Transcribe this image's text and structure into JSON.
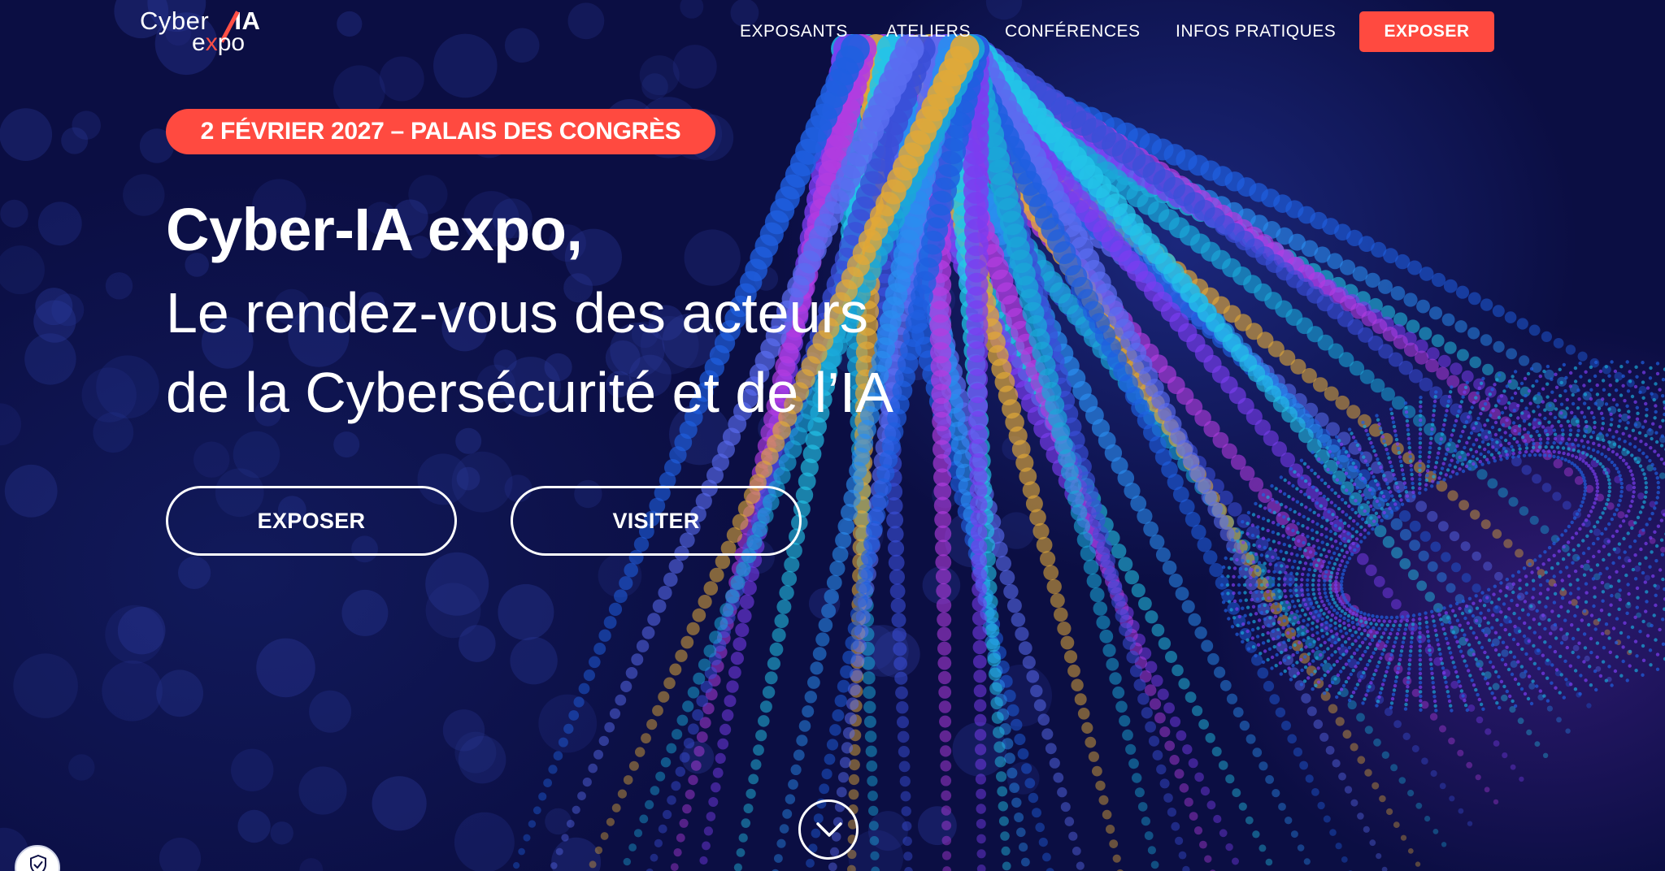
{
  "logo": {
    "word_top": "Cyber",
    "word_ia": "IA",
    "word_bottom_a": "e",
    "word_bottom_x": "x",
    "word_bottom_b": "po",
    "accent_color": "#ff4a40"
  },
  "nav": {
    "items": [
      {
        "label": "EXPOSANTS"
      },
      {
        "label": "ATELIERS"
      },
      {
        "label": "CONFÉRENCES"
      },
      {
        "label": "INFOS PRATIQUES"
      }
    ],
    "cta_label": "EXPOSER"
  },
  "hero": {
    "date_badge": "2 FÉVRIER 2027 – PALAIS DES CONGRÈS",
    "title": "Cyber-IA expo,",
    "subtitle_line1": "Le rendez-vous des acteurs",
    "subtitle_line2": "de la Cybersécurité et de l’IA",
    "button_expose": "EXPOSER",
    "button_visit": "VISITER"
  },
  "icons": {
    "scroll": "chevron-down-icon",
    "privacy": "shield-check-icon"
  },
  "colors": {
    "background": "#0c0f45",
    "accent": "#ff4a40",
    "text": "#ffffff"
  }
}
